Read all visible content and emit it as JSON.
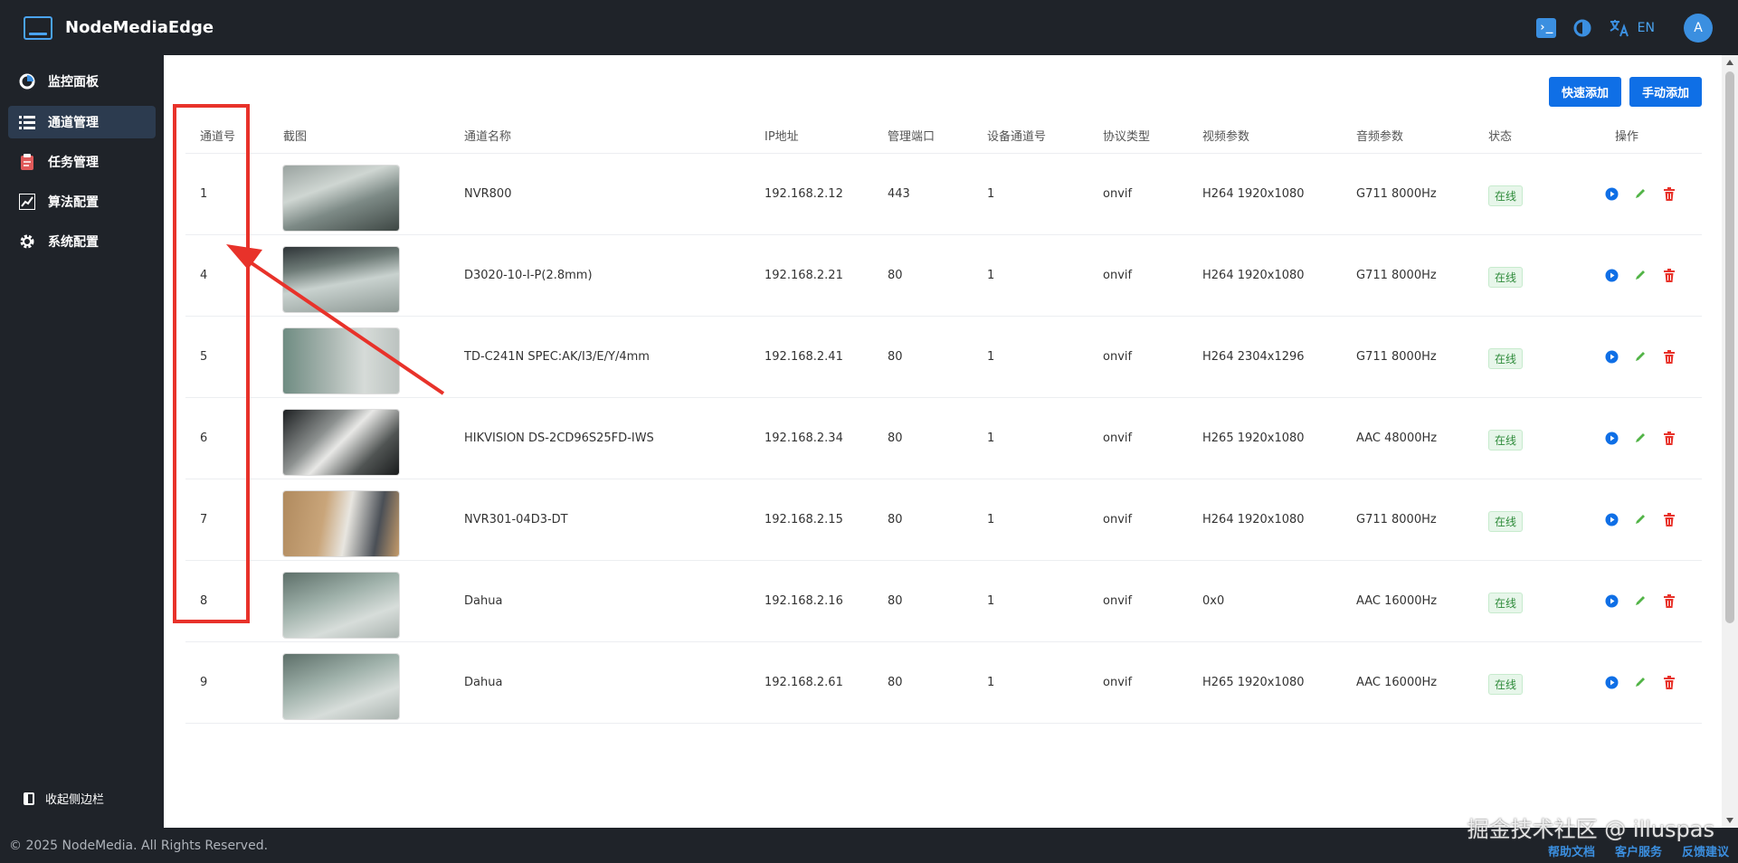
{
  "brand": {
    "name": "NodeMediaEdge"
  },
  "header": {
    "lang_label": "EN",
    "avatar_initial": "A"
  },
  "sidebar": {
    "items": [
      {
        "label": "监控面板"
      },
      {
        "label": "通道管理",
        "active": true
      },
      {
        "label": "任务管理"
      },
      {
        "label": "算法配置"
      },
      {
        "label": "系统配置"
      }
    ],
    "collapse_label": "收起侧边栏"
  },
  "toolbar": {
    "quick_add_label": "快速添加",
    "manual_add_label": "手动添加"
  },
  "table": {
    "headers": [
      "通道号",
      "截图",
      "通道名称",
      "IP地址",
      "管理端口",
      "设备通道号",
      "协议类型",
      "视频参数",
      "音频参数",
      "状态",
      "操作"
    ],
    "rows": [
      {
        "channel": "1",
        "name": "NVR800",
        "ip": "192.168.2.12",
        "port": "443",
        "device_channel": "1",
        "protocol": "onvif",
        "video": "H264 1920x1080",
        "audio": "G711 8000Hz",
        "status": "在线"
      },
      {
        "channel": "4",
        "name": "D3020-10-I-P(2.8mm)",
        "ip": "192.168.2.21",
        "port": "80",
        "device_channel": "1",
        "protocol": "onvif",
        "video": "H264 1920x1080",
        "audio": "G711 8000Hz",
        "status": "在线"
      },
      {
        "channel": "5",
        "name": "TD-C241N SPEC:AK/I3/E/Y/4mm",
        "ip": "192.168.2.41",
        "port": "80",
        "device_channel": "1",
        "protocol": "onvif",
        "video": "H264 2304x1296",
        "audio": "G711 8000Hz",
        "status": "在线"
      },
      {
        "channel": "6",
        "name": "HIKVISION DS-2CD96S25FD-IWS",
        "ip": "192.168.2.34",
        "port": "80",
        "device_channel": "1",
        "protocol": "onvif",
        "video": "H265 1920x1080",
        "audio": "AAC 48000Hz",
        "status": "在线"
      },
      {
        "channel": "7",
        "name": "NVR301-04D3-DT",
        "ip": "192.168.2.15",
        "port": "80",
        "device_channel": "1",
        "protocol": "onvif",
        "video": "H264 1920x1080",
        "audio": "G711 8000Hz",
        "status": "在线"
      },
      {
        "channel": "8",
        "name": "Dahua",
        "ip": "192.168.2.16",
        "port": "80",
        "device_channel": "1",
        "protocol": "onvif",
        "video": "0x0",
        "audio": "AAC 16000Hz",
        "status": "在线"
      },
      {
        "channel": "9",
        "name": "Dahua",
        "ip": "192.168.2.61",
        "port": "80",
        "device_channel": "1",
        "protocol": "onvif",
        "video": "H265 1920x1080",
        "audio": "AAC 16000Hz",
        "status": "在线"
      }
    ]
  },
  "footer": {
    "copyright": "© 2025 NodeMedia. All Rights Reserved.",
    "links": [
      "帮助文档",
      "客户服务",
      "反馈建议"
    ]
  },
  "watermark": "掘金技术社区 @ illuspas",
  "colors": {
    "accent": "#0f6fe6",
    "sidebar_bg": "#1f2329",
    "highlight": "#e8322a",
    "online": "#2e8b3a",
    "delete": "#e8322a",
    "edit": "#52b447"
  }
}
